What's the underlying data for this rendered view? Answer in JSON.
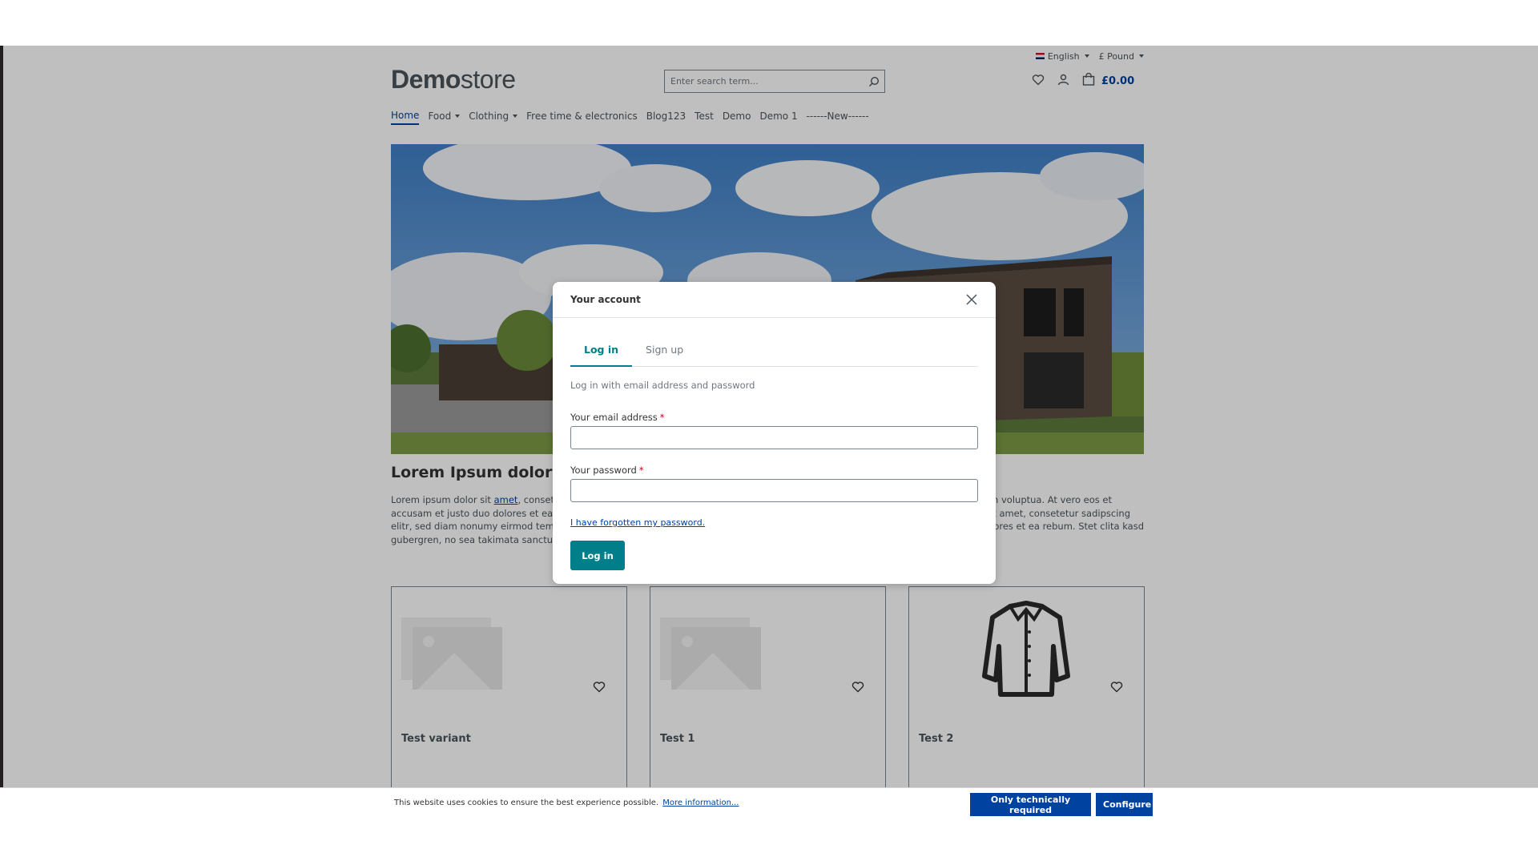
{
  "topbar": {
    "language": "English",
    "currency": "£ Pound"
  },
  "header": {
    "logo_bold": "Demo",
    "logo_light": "store",
    "search_placeholder": "Enter search term...",
    "cart_total": "£0.00"
  },
  "nav": {
    "items": [
      "Home",
      "Food",
      "Clothing",
      "Free time & electronics",
      "Blog123",
      "Test",
      "Demo",
      "Demo 1",
      "------New------"
    ]
  },
  "article": {
    "title": "Lorem Ipsum dolor sit",
    "line1_a": "Lorem ipsum dolor sit ",
    "line1_link": "amet",
    "line1_b": ", consetetu",
    "line1_right": "iam voluptua. At vero eos et",
    "line2_left": "accusam et justo duo dolores et ea reb",
    "line2_right": "r sit amet, consetetur sadipscing",
    "line3_left": "elitr, sed diam nonumy eirmod tempor",
    "line3_right": "dolores et ea rebum. Stet clita kasd",
    "line4_left": "gubergren, no sea takimata sanctus es"
  },
  "products": [
    {
      "title": "Test variant",
      "image": "placeholder-image-icon"
    },
    {
      "title": "Test 1",
      "image": "placeholder-image-icon"
    },
    {
      "title": "Test 2",
      "image": "jacket-icon"
    }
  ],
  "modal": {
    "title": "Your account",
    "tabs": [
      "Log in",
      "Sign up"
    ],
    "hint": "Log in with email address and password",
    "email_label": "Your email address",
    "password_label": "Your password",
    "required_mark": "*",
    "forgot_link": "I have forgotten my password.",
    "login_button": "Log in"
  },
  "cookie": {
    "text": "This website uses cookies to ensure the best experience possible.",
    "more_link": "More information...",
    "btn_required": "Only technically required",
    "btn_configure": "Configure"
  },
  "colors": {
    "brand": "#0042a0",
    "accent": "#007e8a"
  }
}
